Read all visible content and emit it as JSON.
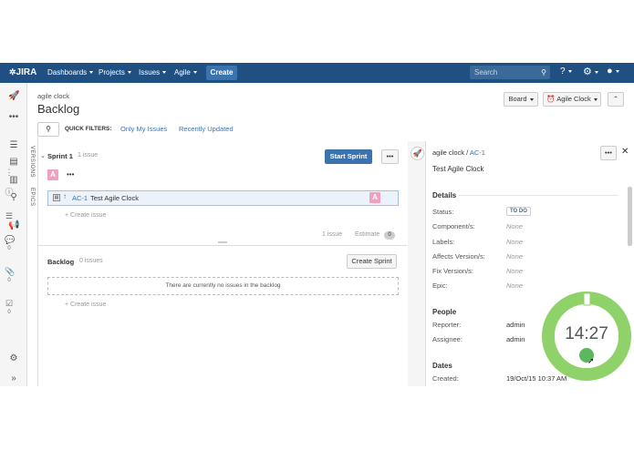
{
  "topbar": {
    "logo": "JIRA",
    "nav": [
      "Dashboards",
      "Projects",
      "Issues",
      "Agile"
    ],
    "create_label": "Create",
    "search_placeholder": "Search"
  },
  "header": {
    "project": "agile clock",
    "title": "Backlog",
    "board_btn": "Board",
    "clock_btn": "Agile Clock",
    "quick_filters_label": "QUICK FILTERS:",
    "filters": [
      "Only My Issues",
      "Recently Updated"
    ]
  },
  "vtabs": [
    "VERSIONS",
    "EPICS"
  ],
  "sprint": {
    "name": "Sprint 1",
    "count": "1 issue",
    "start_btn": "Start Sprint",
    "avatar": "A",
    "issue_key": "AC-1",
    "issue_summary": "Test Agile Clock",
    "create_issue": "Create issue",
    "footer_count": "1 issue",
    "estimate_label": "Estimate",
    "estimate_value": "0"
  },
  "backlog": {
    "name": "Backlog",
    "count": "0 issues",
    "create_sprint_btn": "Create Sprint",
    "empty_text": "There are currently no issues in the backlog",
    "create_issue": "Create issue"
  },
  "detail": {
    "breadcrumb_project": "agile clock",
    "breadcrumb_key": "AC-1",
    "title": "Test Agile Clock",
    "details_heading": "Details",
    "status_label": "Status:",
    "status_value": "TO DO",
    "components_label": "Component/s:",
    "labels_label": "Labels:",
    "affects_label": "Affects Version/s:",
    "fix_label": "Fix Version/s:",
    "epic_label": "Epic:",
    "none_value": "None",
    "people_heading": "People",
    "reporter_label": "Reporter:",
    "reporter_value": "admin",
    "assignee_label": "Assignee:",
    "assignee_value": "admin",
    "dates_heading": "Dates",
    "created_label": "Created:",
    "created_value": "19/Oct/15 10:37 AM",
    "rail_counts": [
      "0",
      "0",
      "0"
    ]
  },
  "clock": {
    "time": "14:27",
    "colors": {
      "ring": "#8fd26a",
      "ring_bg": "#ffffff",
      "button": "#5cb85c"
    }
  },
  "colors": {
    "topbar": "#205081",
    "accent": "#3b73af",
    "avatar": "#f0a1c2"
  }
}
